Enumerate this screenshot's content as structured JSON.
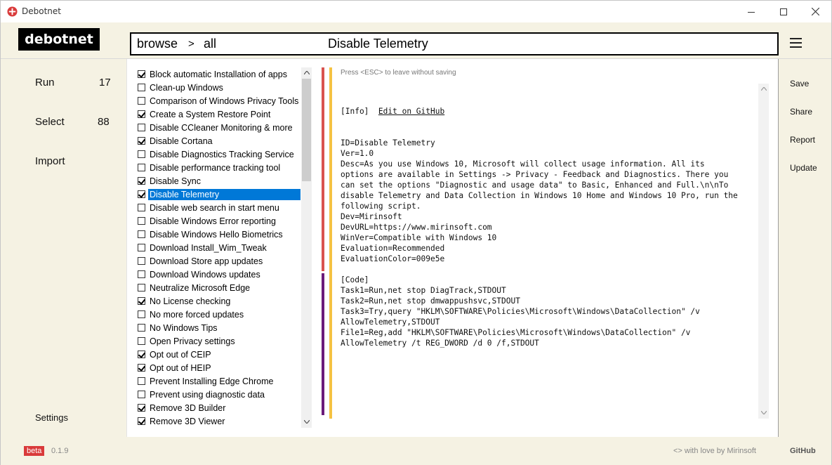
{
  "window": {
    "title": "Debotnet",
    "accent_color": "#d93a3a"
  },
  "header": {
    "logo": "debotnet",
    "crumb_browse": "browse",
    "crumb_sep": ">",
    "crumb_all": "all",
    "selected_title": "Disable Telemetry"
  },
  "nav": {
    "run_label": "Run",
    "run_count": "17",
    "select_label": "Select",
    "select_count": "88",
    "import_label": "Import",
    "settings_label": "Settings"
  },
  "plugins": [
    {
      "label": "Block automatic Installation of apps",
      "checked": true
    },
    {
      "label": "Clean-up Windows",
      "checked": false
    },
    {
      "label": "Comparison of Windows Privacy Tools",
      "checked": false
    },
    {
      "label": "Create a System Restore Point",
      "checked": true
    },
    {
      "label": "Disable CCleaner Monitoring & more",
      "checked": false
    },
    {
      "label": "Disable Cortana",
      "checked": true
    },
    {
      "label": "Disable Diagnostics Tracking Service",
      "checked": false
    },
    {
      "label": "Disable performance tracking tool",
      "checked": false
    },
    {
      "label": "Disable Sync",
      "checked": true
    },
    {
      "label": "Disable Telemetry",
      "checked": true,
      "selected": true
    },
    {
      "label": "Disable web search in start menu",
      "checked": false
    },
    {
      "label": "Disable Windows Error reporting",
      "checked": false
    },
    {
      "label": "Disable Windows Hello Biometrics",
      "checked": false
    },
    {
      "label": "Download Install_Wim_Tweak",
      "checked": false
    },
    {
      "label": "Download Store app updates",
      "checked": false
    },
    {
      "label": "Download Windows updates",
      "checked": false
    },
    {
      "label": "Neutralize Microsoft Edge",
      "checked": false
    },
    {
      "label": "No License checking",
      "checked": true
    },
    {
      "label": "No more forced updates",
      "checked": false
    },
    {
      "label": "No Windows Tips",
      "checked": false
    },
    {
      "label": "Open Privacy settings",
      "checked": false
    },
    {
      "label": "Opt out of CEIP",
      "checked": true
    },
    {
      "label": "Opt out of HEIP",
      "checked": true
    },
    {
      "label": "Prevent Installing Edge Chrome",
      "checked": false
    },
    {
      "label": "Prevent using diagnostic data",
      "checked": false
    },
    {
      "label": "Remove 3D Builder",
      "checked": true
    },
    {
      "label": "Remove 3D Viewer",
      "checked": true
    }
  ],
  "editor": {
    "esc_hint": "Press <ESC> to leave without saving",
    "info_tag": "[Info]",
    "edit_link": "Edit on GitHub",
    "lines": [
      "ID=Disable Telemetry",
      "Ver=1.0",
      "Desc=As you use Windows 10, Microsoft will collect usage information. All its",
      "options are available in Settings -> Privacy - Feedback and Diagnostics. There you",
      "can set the options \"Diagnostic and usage data\" to Basic, Enhanced and Full.\\n\\nTo",
      "disable Telemetry and Data Collection in Windows 10 Home and Windows 10 Pro, run the",
      "following script.",
      "Dev=Mirinsoft",
      "DevURL=https://www.mirinsoft.com",
      "WinVer=Compatible with Windows 10",
      "Evaluation=Recommended",
      "EvaluationColor=009e5e",
      "",
      "[Code]",
      "Task1=Run,net stop DiagTrack,STDOUT",
      "Task2=Run,net stop dmwappushsvc,STDOUT",
      "Task3=Try,query \"HKLM\\SOFTWARE\\Policies\\Microsoft\\Windows\\DataCollection\" /v",
      "AllowTelemetry,STDOUT",
      "File1=Reg,add \"HKLM\\SOFTWARE\\Policies\\Microsoft\\Windows\\DataCollection\" /v",
      "AllowTelemetry /t REG_DWORD /d 0 /f,STDOUT"
    ]
  },
  "actions": {
    "save": "Save",
    "share": "Share",
    "report": "Report",
    "update": "Update"
  },
  "footer": {
    "badge": "beta",
    "version": "0.1.9",
    "credit": "<> with love by Mirinsoft",
    "github": "GitHub"
  },
  "bar_colors": {
    "red": "#d9534f",
    "purple": "#6a1b7a",
    "yellow": "#f5c242"
  }
}
